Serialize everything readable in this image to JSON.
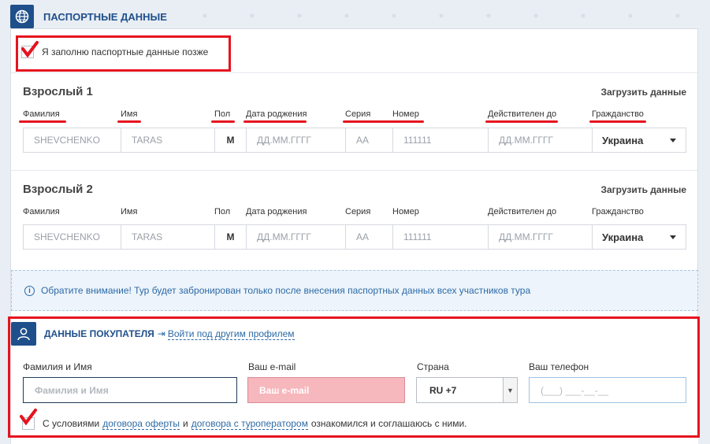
{
  "passport": {
    "title": "ПАСПОРТНЫЕ ДАННЫЕ",
    "later_label": "Я заполню паспортные данные позже",
    "load_label": "Загрузить данные",
    "labels": {
      "surname": "Фамилия",
      "name": "Имя",
      "sex": "Пол",
      "birth": "Дата роджения",
      "series": "Серия",
      "number": "Номер",
      "valid": "Действителен до",
      "citizenship": "Гражданство"
    },
    "travelers": [
      {
        "title": "Взрослый 1",
        "surname": "SHEVCHENKO",
        "name": "TARAS",
        "sex": "М",
        "birth_placeholder": "ДД.ММ.ГГГГ",
        "series": "АА",
        "number": "111111",
        "valid_placeholder": "ДД.ММ.ГГГГ",
        "citizenship": "Украина"
      },
      {
        "title": "Взрослый 2",
        "surname": "SHEVCHENKO",
        "name": "TARAS",
        "sex": "М",
        "birth_placeholder": "ДД.ММ.ГГГГ",
        "series": "АА",
        "number": "111111",
        "valid_placeholder": "ДД.ММ.ГГГГ",
        "citizenship": "Украина"
      }
    ],
    "notice": "Обратите внимание! Тур будет забронирован только после внесения паспортных данных всех участников тура"
  },
  "buyer": {
    "title": "ДАННЫЕ ПОКУПАТЕЛЯ",
    "other_profile": "Войти под другим профилем",
    "name_label": "Фамилия и Имя",
    "name_placeholder": "Фамилия и Имя",
    "email_label": "Ваш e-mail",
    "email_placeholder": "Ваш e-mail",
    "country_label": "Страна",
    "country_value": "RU +7",
    "phone_label": "Ваш телефон",
    "phone_placeholder": "(___) ___-__-__",
    "terms_prefix": "С условиями",
    "terms_link1": "договора оферты",
    "terms_and": "и",
    "terms_link2": "договора с туроператором",
    "terms_suffix": "ознакомился и соглашаюсь с ними."
  },
  "colors": {
    "brand": "#1f4f8b",
    "link": "#2d6aa6",
    "annotation": "#e5141f",
    "error_field": "#f6b7bd"
  }
}
